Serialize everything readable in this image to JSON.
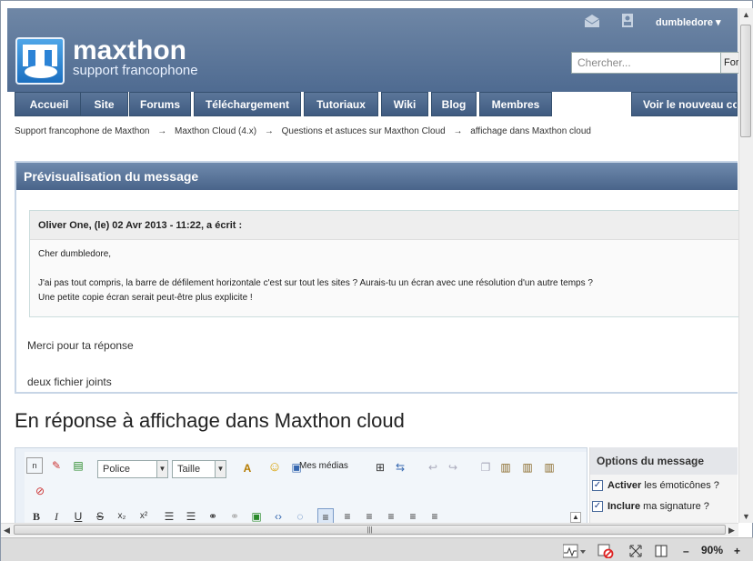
{
  "header": {
    "brand": "maxthon",
    "subtitle": "support francophone",
    "user": "dumbledore",
    "search_placeholder": "Chercher...",
    "search_button": "For"
  },
  "nav": {
    "tabs": [
      "Accueil",
      "Site",
      "Forums",
      "Téléchargement",
      "Tutoriaux",
      "Wiki",
      "Blog",
      "Membres"
    ],
    "right_tab": "Voir le nouveau co"
  },
  "breadcrumb": [
    "Support francophone de Maxthon",
    "→",
    "Maxthon Cloud (4.x)",
    "→",
    "Questions et astuces sur Maxthon Cloud",
    "→",
    "affichage dans Maxthon cloud"
  ],
  "preview": {
    "title": "Prévisualisation du message",
    "quote_author": "Oliver One, (le) 02 Avr 2013 - 11:22, a écrit :",
    "quote_lines": [
      "Cher dumbledore,",
      "",
      "J'ai pas tout compris, la barre de défilement horizontale c'est sur tout les sites ? Aurais-tu un écran avec une résolution d'un autre temps ?",
      "Une petite copie écran serait peut-être plus explicite !"
    ],
    "message_line1": "Merci pour ta réponse",
    "message_line2": "deux fichier joints"
  },
  "reply_title": "En réponse à affichage dans Maxthon cloud",
  "editor": {
    "font_select": "Police",
    "size_select": "Taille",
    "medias_label": "Mes médias"
  },
  "options": {
    "title": "Options du message",
    "opt1_bold": "Activer",
    "opt1_rest": " les émoticônes ?",
    "opt2_bold": "Inclure",
    "opt2_rest": " ma signature ?"
  },
  "status": {
    "zoom": "90%",
    "minus": "–",
    "plus": "+"
  }
}
